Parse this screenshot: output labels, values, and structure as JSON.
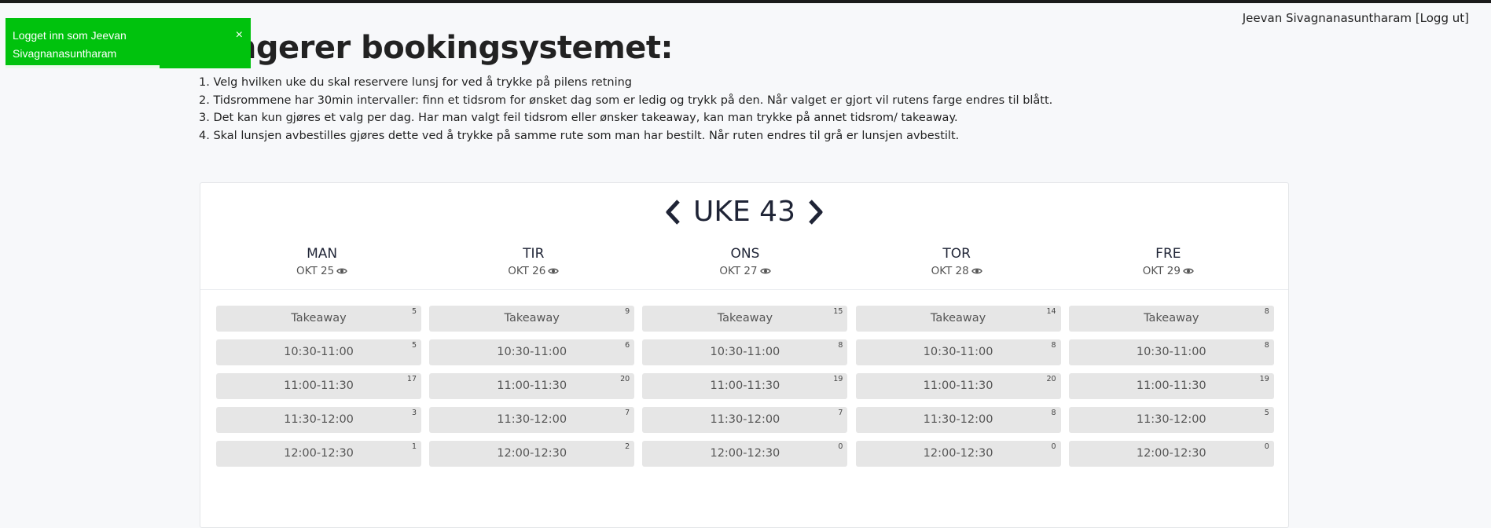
{
  "user": {
    "name": "Jeevan Sivagnanasuntharam",
    "logout_label": "[Logg ut]"
  },
  "toast": {
    "message": "Logget inn som Jeevan Sivagnanasuntharam",
    "close_label": "×"
  },
  "page": {
    "title": "fungerer bookingsystemet:",
    "steps": [
      "1. Velg hvilken uke du skal reservere lunsj for ved å trykke på pilens retning",
      "2. Tidsrommene har 30min intervaller: finn et tidsrom for ønsket dag som er ledig og trykk på den. Når valget er gjort vil rutens farge endres til blått.",
      "3. Det kan kun gjøres et valg per dag. Har man valgt feil tidsrom eller ønsker takeaway, kan man trykke på annet tidsrom/ takeaway.",
      "4. Skal lunsjen avbestilles gjøres dette ved å trykke på samme rute som man har bestilt. Når ruten endres til grå er lunsjen avbestilt."
    ]
  },
  "week": {
    "label": "UKE 43",
    "prev_icon": "chevron-left-icon",
    "next_icon": "chevron-right-icon"
  },
  "days": [
    {
      "name": "MAN",
      "date": "OKT 25",
      "slots": [
        {
          "label": "Takeaway",
          "count": "5"
        },
        {
          "label": "10:30-11:00",
          "count": "5"
        },
        {
          "label": "11:00-11:30",
          "count": "17"
        },
        {
          "label": "11:30-12:00",
          "count": "3"
        },
        {
          "label": "12:00-12:30",
          "count": "1"
        }
      ]
    },
    {
      "name": "TIR",
      "date": "OKT 26",
      "slots": [
        {
          "label": "Takeaway",
          "count": "9"
        },
        {
          "label": "10:30-11:00",
          "count": "6"
        },
        {
          "label": "11:00-11:30",
          "count": "20"
        },
        {
          "label": "11:30-12:00",
          "count": "7"
        },
        {
          "label": "12:00-12:30",
          "count": "2"
        }
      ]
    },
    {
      "name": "ONS",
      "date": "OKT 27",
      "slots": [
        {
          "label": "Takeaway",
          "count": "15"
        },
        {
          "label": "10:30-11:00",
          "count": "8"
        },
        {
          "label": "11:00-11:30",
          "count": "19"
        },
        {
          "label": "11:30-12:00",
          "count": "7"
        },
        {
          "label": "12:00-12:30",
          "count": "0"
        }
      ]
    },
    {
      "name": "TOR",
      "date": "OKT 28",
      "slots": [
        {
          "label": "Takeaway",
          "count": "14"
        },
        {
          "label": "10:30-11:00",
          "count": "8"
        },
        {
          "label": "11:00-11:30",
          "count": "20"
        },
        {
          "label": "11:30-12:00",
          "count": "8"
        },
        {
          "label": "12:00-12:30",
          "count": "0"
        }
      ]
    },
    {
      "name": "FRE",
      "date": "OKT 29",
      "slots": [
        {
          "label": "Takeaway",
          "count": "8"
        },
        {
          "label": "10:30-11:00",
          "count": "8"
        },
        {
          "label": "11:00-11:30",
          "count": "19"
        },
        {
          "label": "11:30-12:00",
          "count": "5"
        },
        {
          "label": "12:00-12:30",
          "count": "0"
        }
      ]
    }
  ],
  "colors": {
    "toast_bg": "#00c20d",
    "slot_bg": "#e6e6e6",
    "heading": "#1f2436"
  }
}
